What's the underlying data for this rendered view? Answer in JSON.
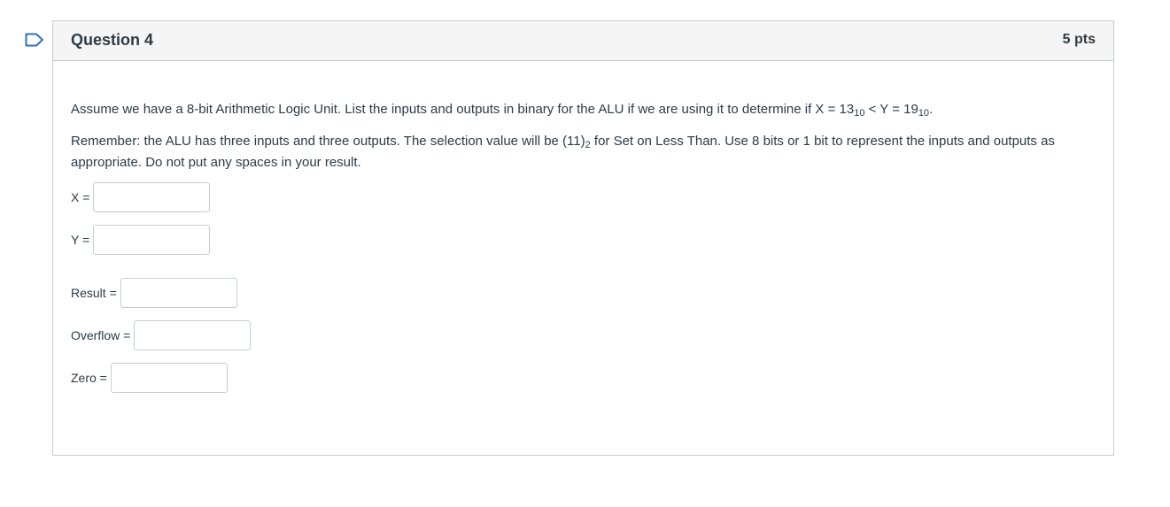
{
  "question": {
    "title": "Question 4",
    "points": "5 pts",
    "line1_prefix": "Assume we have a 8-bit Arithmetic Logic Unit. List the inputs and outputs in binary for the ALU if we are using it to determine if X = 13",
    "line1_sub1": "10",
    "line1_mid": " < Y = 19",
    "line1_sub2": "10",
    "line1_suffix": ".",
    "line2_prefix": "Remember: the ALU has three inputs and three outputs. The selection value will be (11)",
    "line2_sub": "2",
    "line2_suffix": " for Set on Less Than. Use 8 bits or 1 bit to represent the inputs and outputs as appropriate. Do not put any spaces in your result."
  },
  "fields": {
    "x_label": "X =",
    "x_value": "",
    "y_label": "Y =",
    "y_value": "",
    "result_label": "Result =",
    "result_value": "",
    "overflow_label": "Overflow =",
    "overflow_value": "",
    "zero_label": "Zero =",
    "zero_value": ""
  },
  "colors": {
    "flag": "#2d72b5",
    "border": "#c7cdd1",
    "header_bg": "#f5f5f5",
    "text": "#2d3b45"
  },
  "icons": {
    "flag": "flag-question-icon"
  }
}
